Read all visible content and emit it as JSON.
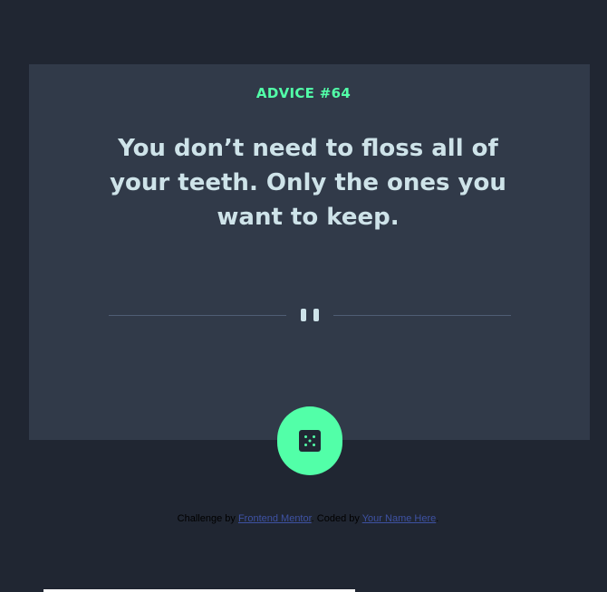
{
  "advice": {
    "label": "ADVICE #64",
    "text": "You don’t need to floss all of your teeth. Only the ones you want to keep."
  },
  "attribution": {
    "prefix": "Challenge by ",
    "link1": "Frontend Mentor",
    "middle": ". Coded by ",
    "link2": "Your Name Here",
    "suffix": "."
  },
  "icons": {
    "divider": "pause-icon",
    "button": "dice-icon"
  },
  "colors": {
    "background": "#202632",
    "card": "#313a49",
    "accent": "#52ffa8",
    "text": "#cee3e9",
    "divider": "#4f5d74",
    "link": "#3e52a3"
  }
}
